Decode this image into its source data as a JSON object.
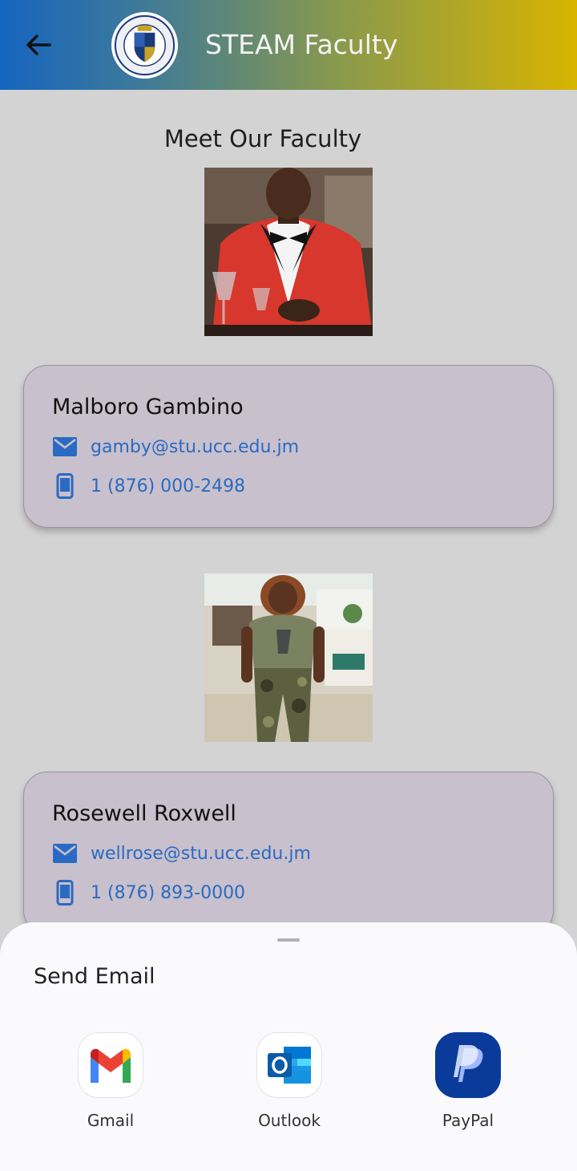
{
  "appbar": {
    "title": "STEAM Faculty",
    "back_icon": "arrow-back-icon",
    "logo_icon": "university-seal-logo",
    "gradient": [
      "#1565c0",
      "#d8b400"
    ]
  },
  "main": {
    "section_title": "Meet Our Faculty",
    "faculty": [
      {
        "name": "Malboro Gambino",
        "email": "gamby@stu.ucc.edu.jm",
        "phone": "1 (876) 000-2498",
        "photo": "faculty-photo"
      },
      {
        "name": "Rosewell Roxwell",
        "email": "wellrose@stu.ucc.edu.jm",
        "phone": "1 (876) 893-0000",
        "photo": "faculty-photo"
      }
    ],
    "link_color": "#2a6ac2"
  },
  "sheet": {
    "title": "Send Email",
    "apps": [
      {
        "label": "Gmail",
        "icon": "gmail-icon"
      },
      {
        "label": "Outlook",
        "icon": "outlook-icon"
      },
      {
        "label": "PayPal",
        "icon": "paypal-icon"
      }
    ]
  }
}
